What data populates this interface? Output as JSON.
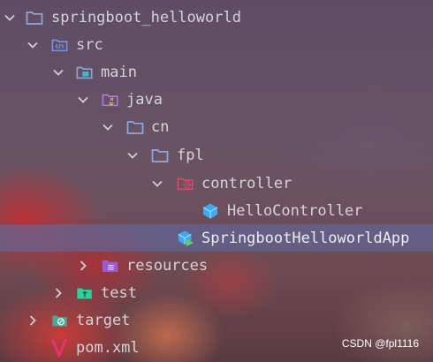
{
  "tree": {
    "project": "springboot_helloworld",
    "src": "src",
    "main": "main",
    "java": "java",
    "cn": "cn",
    "fpl": "fpl",
    "controller": "controller",
    "hello_controller": "HelloController",
    "app": "SpringbootHelloworldApp",
    "resources": "resources",
    "test": "test",
    "target": "target",
    "pom": "pom.xml"
  },
  "icons": {
    "project": "folder-icon",
    "src": "source-folder-icon",
    "main": "module-folder-icon",
    "java": "java-package-folder-icon",
    "cn": "folder-icon",
    "fpl": "folder-icon",
    "controller": "spring-config-folder-icon",
    "hello_controller": "class-icon",
    "app": "spring-boot-app-icon",
    "resources": "resources-folder-icon",
    "test": "test-folder-icon",
    "target": "excluded-folder-icon",
    "pom": "maven-icon"
  },
  "colors": {
    "text": "#d4d4d8",
    "selection": "#5f69a0",
    "folder_blue": "#8ea8df",
    "source_blue": "#6f96e8",
    "java_purple": "#b27ae0",
    "spring_red": "#e0456d",
    "class_blue": "#3fa8f0",
    "resources_purple": "#9e5bd6",
    "test_green": "#2bd29b",
    "target_green": "#4aa89a",
    "maven_pink": "#e8336f"
  },
  "watermark": "CSDN @fpl1116"
}
